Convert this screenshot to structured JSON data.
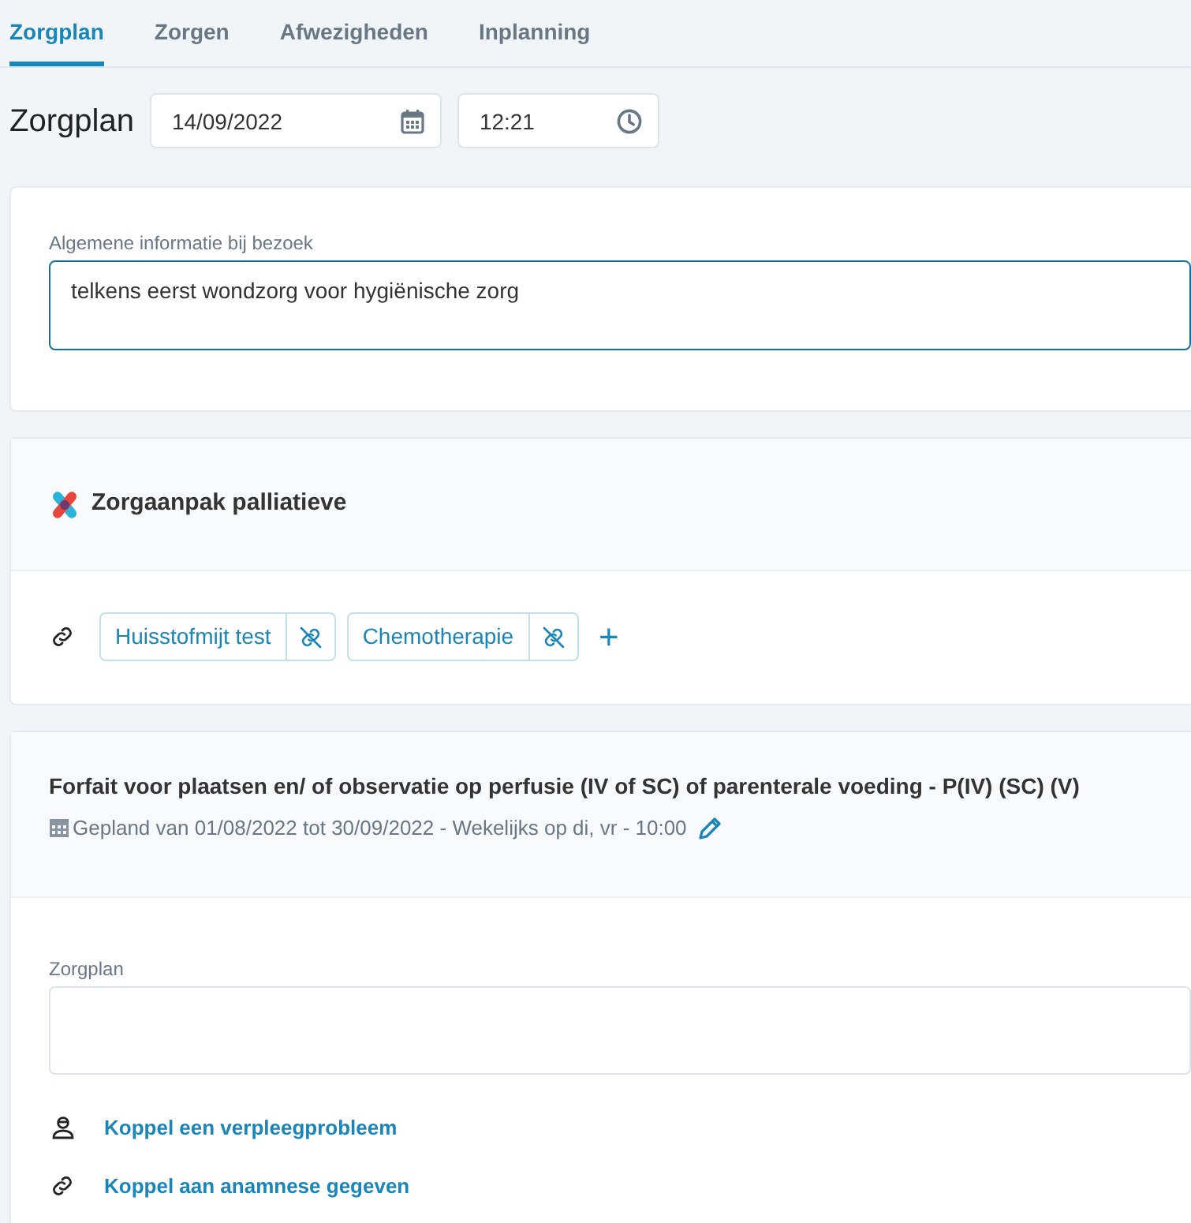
{
  "tabs": [
    {
      "label": "Zorgplan",
      "selected": true
    },
    {
      "label": "Zorgen",
      "selected": false
    },
    {
      "label": "Afwezigheden",
      "selected": false
    },
    {
      "label": "Inplanning",
      "selected": false
    }
  ],
  "header": {
    "title": "Zorgplan",
    "date": "14/09/2022",
    "time": "12:21"
  },
  "general_info": {
    "label": "Algemene informatie bij bezoek",
    "value": "telkens eerst wondzorg voor hygiënische zorg",
    "focused": true
  },
  "care_approach": {
    "title": "Zorgaanpak palliatieve",
    "linked_items": [
      {
        "label": "Huisstofmijt test"
      },
      {
        "label": "Chemotherapie"
      }
    ],
    "add_button": "+"
  },
  "care_item": {
    "title": "Forfait voor plaatsen en/ of observatie op perfusie (IV of SC) of parenterale voeding - P(IV) (SC) (V)",
    "schedule": "Gepland van 01/08/2022 tot 30/09/2022 - Wekelijks op di, vr - 10:00",
    "plan_field": {
      "label": "Zorgplan"
    },
    "links": [
      {
        "kind": "problem",
        "label": "Koppel een verpleegprobleem"
      },
      {
        "kind": "anamnesis",
        "label": "Koppel aan anamnese gegeven"
      }
    ]
  }
}
